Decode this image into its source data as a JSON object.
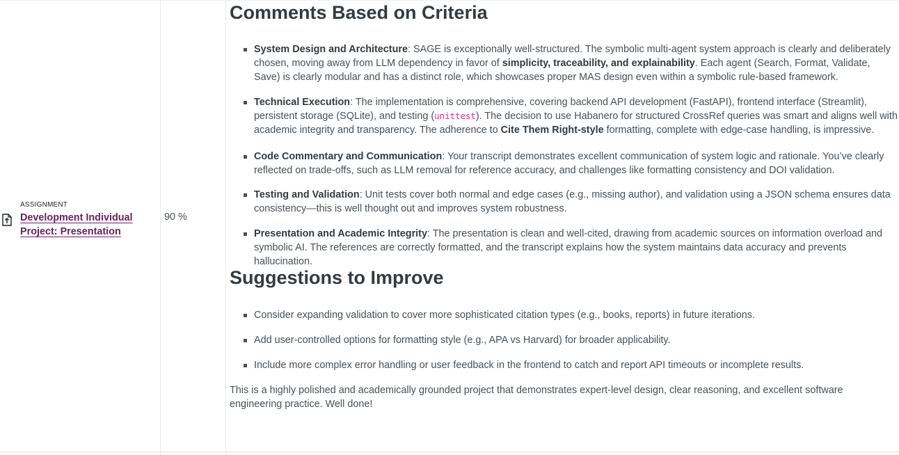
{
  "item": {
    "type_label": "ASSIGNMENT",
    "title": "Development Individual Project: Presentation"
  },
  "grade": {
    "value": "90 %"
  },
  "feedback": {
    "heading_criteria": "Comments Based on Criteria",
    "criteria": [
      {
        "name": "System Design and Architecture",
        "t1": ": SAGE is exceptionally well-structured. The symbolic multi-agent system approach is clearly and deliberately chosen, moving away from LLM dependency in favor of ",
        "b1": "simplicity, traceability, and explainability",
        "t2": ". Each agent (Search, Format, Validate, Save) is clearly modular and has a distinct role, which showcases proper MAS design even within a symbolic rule-based framework."
      },
      {
        "name": "Technical Execution",
        "t1": ": The implementation is comprehensive, covering backend API development (FastAPI), frontend interface (Streamlit), persistent storage (SQLite), and testing (",
        "code": "unittest",
        "t2": "). The decision to use Habanero for structured CrossRef queries was smart and aligns well with academic integrity and transparency. The adherence to ",
        "b1": "Cite Them Right-style",
        "t3": " formatting, complete with edge-case handling, is impressive."
      },
      {
        "name": "Code Commentary and Communication",
        "t1": ": Your transcript demonstrates excellent communication of system logic and rationale. You’ve clearly reflected on trade-offs, such as LLM removal for reference accuracy, and challenges like formatting consistency and DOI validation."
      },
      {
        "name": "Testing and Validation",
        "t1": ": Unit tests cover both normal and edge cases (e.g., missing author), and validation using a JSON schema ensures data consistency—this is well thought out and improves system robustness."
      },
      {
        "name": "Presentation and Academic Integrity",
        "t1": ": The presentation is clean and well-cited, drawing from academic sources on information overload and symbolic AI. The references are correctly formatted, and the transcript explains how the system maintains data accuracy and prevents hallucination."
      }
    ],
    "heading_suggestions": "Suggestions to Improve",
    "suggestions": [
      "Consider expanding validation to cover more sophisticated citation types (e.g., books, reports) in future iterations.",
      "Add user-controlled options for formatting style (e.g., APA vs Harvard) for broader applicability.",
      "Include more complex error handling or user feedback in the frontend to catch and report API timeouts or incomplete results."
    ],
    "closing": "This is a highly polished and academically grounded project that demonstrates expert-level design, clear reasoning, and excellent software engineering practice. Well done!"
  }
}
